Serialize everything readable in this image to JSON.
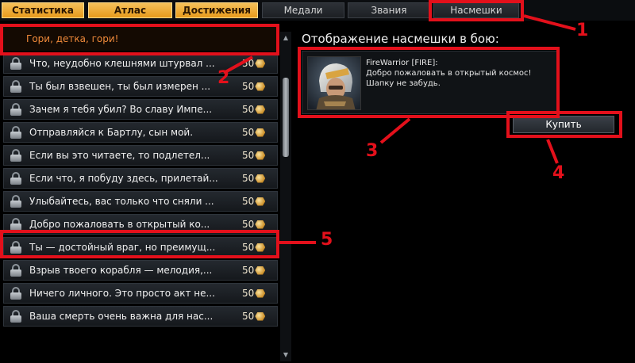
{
  "tabs": [
    {
      "label": "Статистика",
      "style": "gold"
    },
    {
      "label": "Атлас",
      "style": "gold"
    },
    {
      "label": "Достижения",
      "style": "gold"
    },
    {
      "label": "Медали",
      "style": "dark"
    },
    {
      "label": "Звания",
      "style": "dark"
    },
    {
      "label": "Насмешки",
      "style": "dark"
    }
  ],
  "list": {
    "selected": "Гори, детка, гори!",
    "items": [
      {
        "text": "Что, неудобно клешнями штурвал ...",
        "price": "50"
      },
      {
        "text": "Ты был взвешен, ты был измерен ...",
        "price": "50"
      },
      {
        "text": "Зачем я тебя убил? Во славу Импе...",
        "price": "50"
      },
      {
        "text": "Отправляйся к Бартлу, сын мой.",
        "price": "50"
      },
      {
        "text": "Если вы это читаете, то подлетел...",
        "price": "50"
      },
      {
        "text": "Если что, я побуду здесь, прилетай...",
        "price": "50"
      },
      {
        "text": "Улыбайтесь, вас только что сняли ...",
        "price": "50"
      },
      {
        "text": "Добро пожаловать в открытый ко...",
        "price": "50"
      },
      {
        "text": "Ты — достойный враг, но преимущ...",
        "price": "50"
      },
      {
        "text": "Взрыв твоего корабля — мелодия,...",
        "price": "50"
      },
      {
        "text": "Ничего личного. Это просто акт не...",
        "price": "50"
      },
      {
        "text": "Ваша смерть очень важна для нас...",
        "price": "50"
      }
    ]
  },
  "preview": {
    "title": "Отображение насмешки в бою:",
    "player": "FireWarrior [FIRE]:",
    "line1": "Добро пожаловать в открытый космос!",
    "line2": "Шапку не забудь."
  },
  "buy_label": "Купить",
  "annotations": {
    "n1": "1",
    "n2": "2",
    "n3": "3",
    "n4": "4",
    "n5": "5"
  },
  "colors": {
    "accent_gold": "#e79a1c",
    "annotation_red": "#e3101b",
    "selected_text": "#f08a3a"
  },
  "icons": {
    "lock": "lock-icon",
    "coin": "coin-icon",
    "portrait": "pilot-avatar"
  }
}
